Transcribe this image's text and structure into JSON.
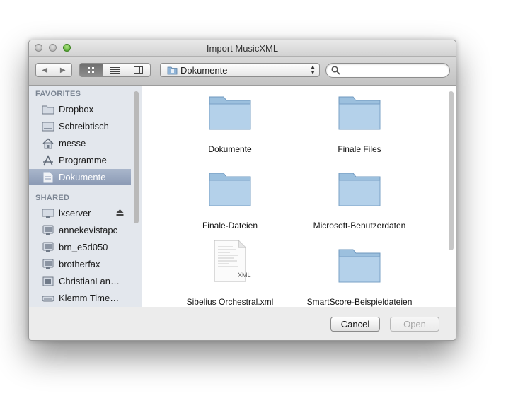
{
  "window": {
    "title": "Import MusicXML"
  },
  "toolbar": {
    "back_icon": "chevron-left-icon",
    "forward_icon": "chevron-right-icon",
    "view_modes": [
      "icon-view-icon",
      "list-view-icon",
      "column-view-icon"
    ],
    "location": "Dokumente",
    "search_placeholder": ""
  },
  "sidebar": {
    "favorites_title": "FAVORITES",
    "favorites": [
      {
        "label": "Dropbox",
        "icon": "folder-icon"
      },
      {
        "label": "Schreibtisch",
        "icon": "desktop-icon"
      },
      {
        "label": "messe",
        "icon": "home-icon"
      },
      {
        "label": "Programme",
        "icon": "applications-icon"
      },
      {
        "label": "Dokumente",
        "icon": "documents-icon",
        "selected": true
      }
    ],
    "shared_title": "SHARED",
    "shared": [
      {
        "label": "lxserver",
        "icon": "monitor-icon",
        "eject": true
      },
      {
        "label": "annekevistapc",
        "icon": "pc-icon"
      },
      {
        "label": "brn_e5d050",
        "icon": "pc-icon"
      },
      {
        "label": "brotherfax",
        "icon": "pc-icon"
      },
      {
        "label": "ChristianLan…",
        "icon": "server-icon"
      },
      {
        "label": "Klemm Time…",
        "icon": "drive-icon"
      }
    ]
  },
  "files": [
    {
      "name": "Dokumente",
      "kind": "folder"
    },
    {
      "name": "Finale Files",
      "kind": "folder"
    },
    {
      "name": "Finale-Dateien",
      "kind": "folder"
    },
    {
      "name": "Microsoft-Benutzerdaten",
      "kind": "folder"
    },
    {
      "name": "Sibelius Orchestral.xml",
      "kind": "xml",
      "badge": "XML"
    },
    {
      "name": "SmartScore-Beispieldateien",
      "kind": "folder"
    }
  ],
  "buttons": {
    "cancel": "Cancel",
    "open": "Open"
  }
}
